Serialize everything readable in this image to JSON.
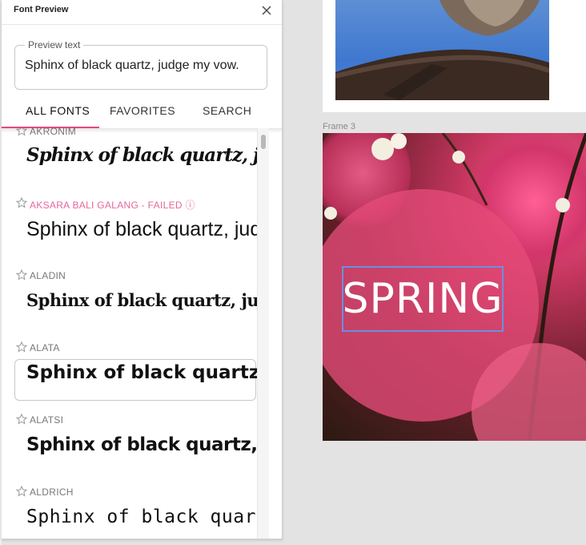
{
  "panel": {
    "title": "Font Preview",
    "close_icon": "close-icon",
    "preview_label": "Preview text",
    "preview_value": "Sphinx of black quartz, judge my vow.",
    "tabs": [
      {
        "label": "ALL FONTS",
        "active": true
      },
      {
        "label": "FAVORITES",
        "active": false
      },
      {
        "label": "SEARCH",
        "active": false
      }
    ],
    "accent_color": "#e44b7c",
    "fonts": [
      {
        "name": "AKRONIM",
        "sample": "Sphinx of black quartz, judge my vow.",
        "failed": false
      },
      {
        "name": "AKSARA BALI GALANG - FAILED ⓘ",
        "sample": "Sphinx of black quartz, judge my vow.",
        "failed": true
      },
      {
        "name": "ALADIN",
        "sample": "Sphinx of black quartz, judge my vow.",
        "failed": false
      },
      {
        "name": "ALATA",
        "sample": "Sphinx of black quartz, judge my vow.",
        "failed": false,
        "selected": true
      },
      {
        "name": "ALATSI",
        "sample": "Sphinx of black quartz, judge my vow.",
        "failed": false
      },
      {
        "name": "ALDRICH",
        "sample": "Sphinx of black quartz, judge my vow.",
        "failed": false
      }
    ]
  },
  "canvas": {
    "frame3_label": "Frame 3",
    "spring_text": "SPRING",
    "selection_color": "#6b8fe0"
  }
}
